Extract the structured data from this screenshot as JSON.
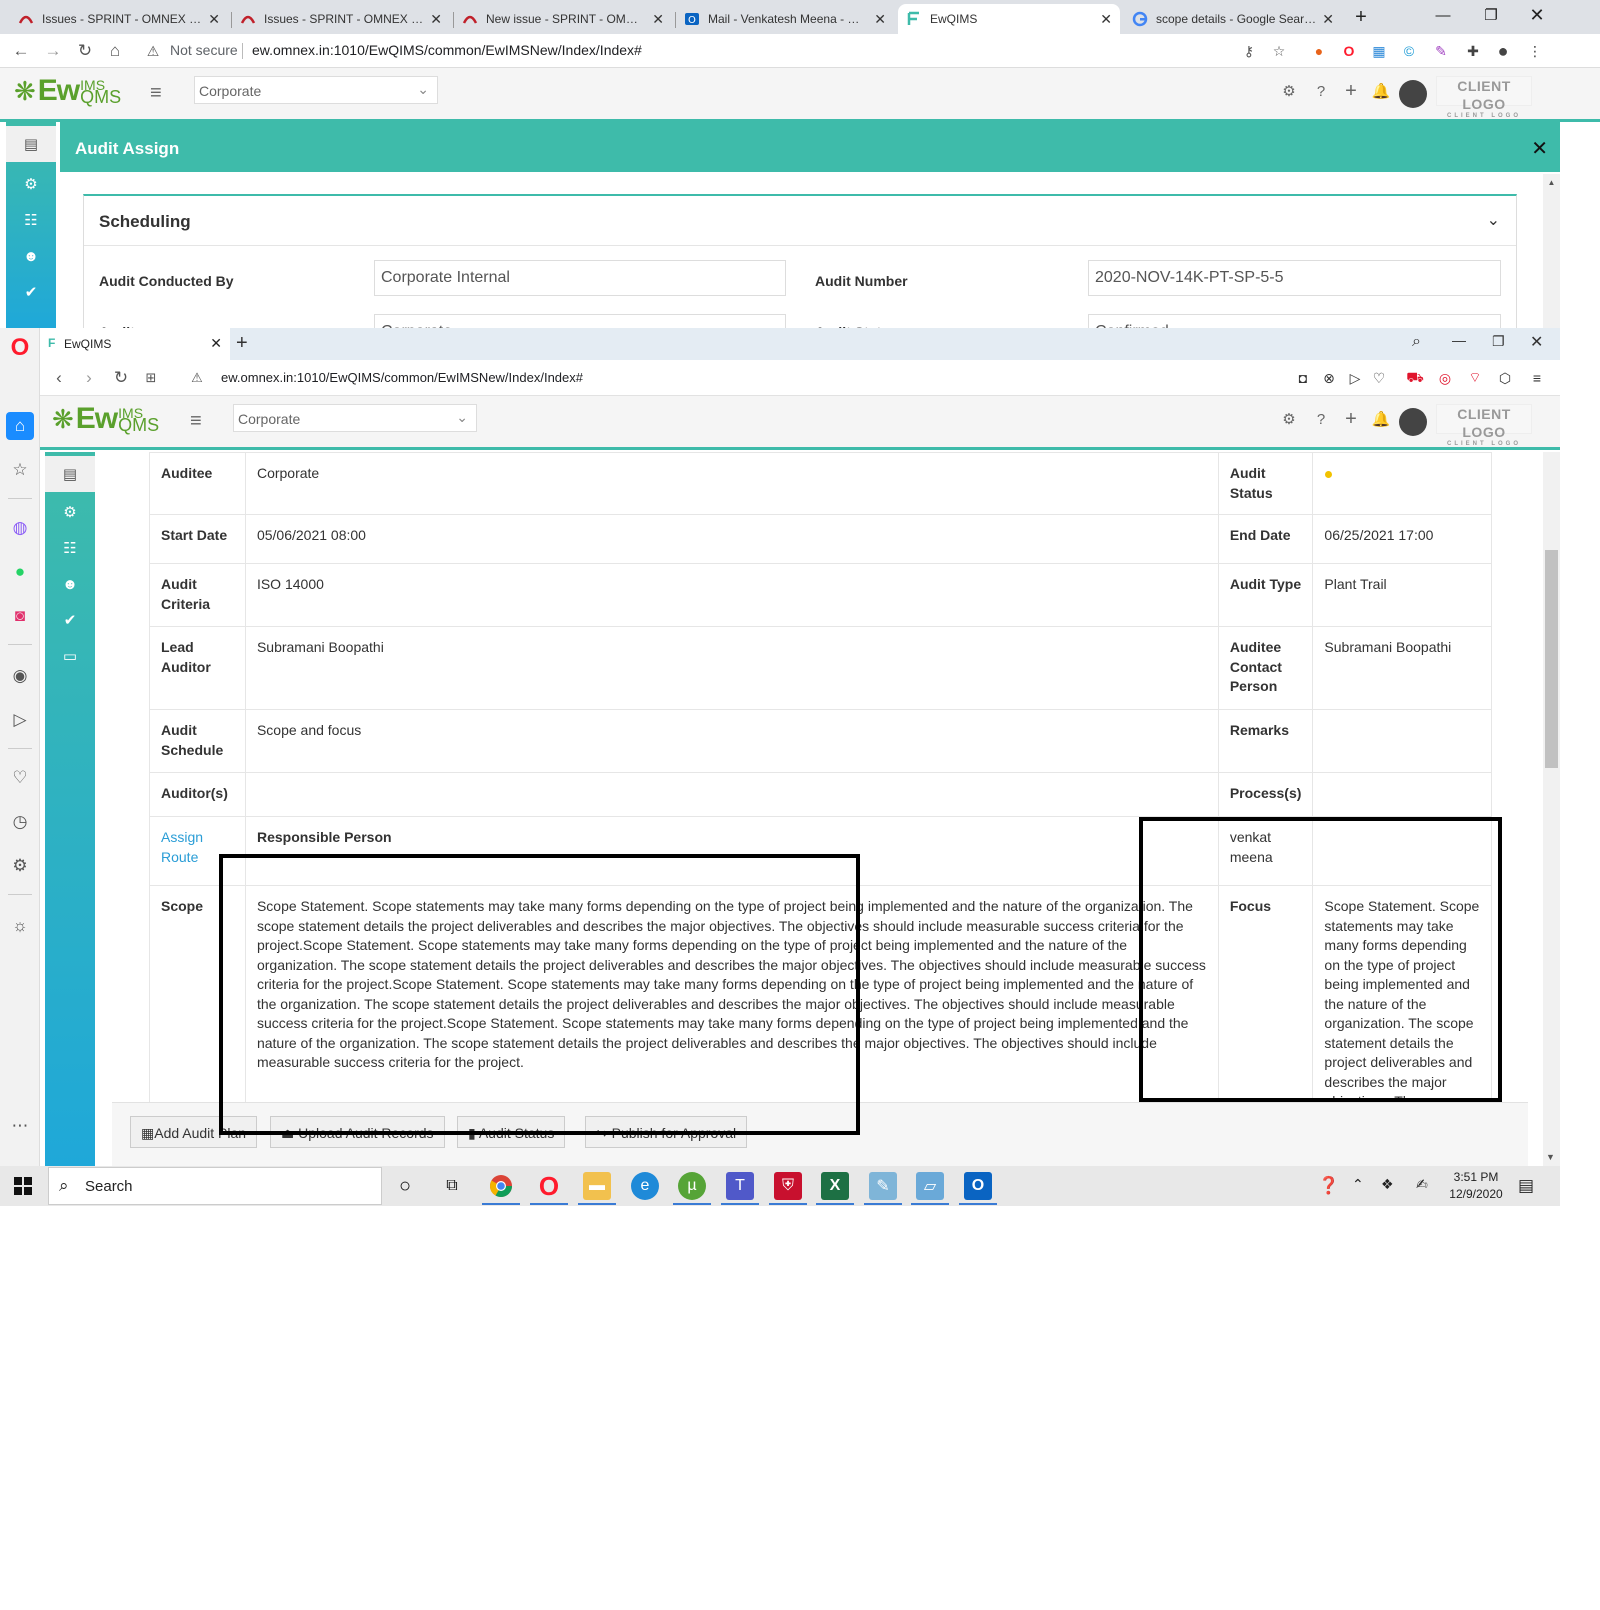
{
  "outer_browser": {
    "tabs": [
      {
        "title": "Issues - SPRINT - OMNEX ISSUE"
      },
      {
        "title": "Issues - SPRINT - OMNEX ISSUE"
      },
      {
        "title": "New issue - SPRINT - OMNEX ISSUE"
      },
      {
        "title": "Mail - Venkatesh Meena - Outlook"
      },
      {
        "title": "EwQIMS"
      },
      {
        "title": "scope details - Google Search"
      }
    ],
    "security_label": "Not secure",
    "url": "ew.omnex.in:1010/EwQIMS/common/EwIMSNew/Index/Index#"
  },
  "app_header": {
    "logo_ew": "Ew",
    "logo_ims": "IMS",
    "logo_qms": "QMS",
    "selector_value": "Corporate",
    "client_logo": "CLIENT LOGO",
    "client_logo_sub": "CLIENT LOGO"
  },
  "audit_assign": {
    "title": "Audit Assign",
    "section_title": "Scheduling",
    "fields": {
      "conducted_by_label": "Audit Conducted By",
      "conducted_by_value": "Corporate Internal",
      "audit_number_label": "Audit Number",
      "audit_number_value": "2020-NOV-14K-PT-SP-5-5",
      "auditee_label": "Auditee",
      "auditee_value": "Corporate",
      "audit_status_label": "Audit Status",
      "audit_status_value": "Confirmed"
    }
  },
  "inner_browser": {
    "tab_title": "EwQIMS",
    "url": "ew.omnex.in:1010/EwQIMS/common/EwIMSNew/Index/Index#"
  },
  "details": {
    "auditee_label": "Auditee",
    "auditee_value": "Corporate",
    "audit_status_label": "Audit Status",
    "start_date_label": "Start Date",
    "start_date_value": "05/06/2021 08:00",
    "end_date_label": "End Date",
    "end_date_value": "06/25/2021 17:00",
    "criteria_label": "Audit Criteria",
    "criteria_value": "ISO 14000",
    "audit_type_label": "Audit Type",
    "audit_type_value": "Plant Trail",
    "lead_auditor_label": "Lead Auditor",
    "lead_auditor_value": "Subramani Boopathi",
    "contact_label": "Auditee Contact Person",
    "contact_value": "Subramani Boopathi",
    "schedule_label": "Audit Schedule",
    "schedule_value": "Scope and focus",
    "remarks_label": "Remarks",
    "auditors_label": "Auditor(s)",
    "processes_label": "Process(s)",
    "assign_route_label": "Assign Route",
    "responsible_label": "Responsible Person",
    "responsible_value": "venkat meena",
    "scope_label": "Scope",
    "scope_value": "Scope Statement. Scope statements may take many forms depending on the type of project being implemented and the nature of the organization. The scope statement details the project deliverables and describes the major objectives. The objectives should include measurable success criteria for the project.Scope Statement. Scope statements may take many forms depending on the type of project being implemented and the nature of the organization. The scope statement details the project deliverables and describes the major objectives. The objectives should include measurable success criteria for the project.Scope Statement. Scope statements may take many forms depending on the type of project being implemented and the nature of the organization. The scope statement details the project deliverables and describes the major objectives. The objectives should include measurable success criteria for the project.Scope Statement. Scope statements may take many forms depending on the type of project being implemented and the nature of the organization. The scope statement details the project deliverables and describes the major objectives. The objectives should include measurable success criteria for the project.",
    "focus_label": "Focus",
    "focus_value": "Scope Statement. Scope statements may take many forms depending on the type of project being implemented and the nature of the organization. The scope statement details the project deliverables and describes the major objectives. The"
  },
  "actions": {
    "add_plan": "Add Audit Plan",
    "upload_records": "Upload Audit Records",
    "audit_status": "Audit Status",
    "publish": "Publish for Approval"
  },
  "taskbar": {
    "search_label": "Search",
    "time": "3:51 PM",
    "date": "12/9/2020"
  },
  "colors": {
    "teal": "#3ebbaa",
    "link_blue": "#2a9dd6",
    "status_yellow": "#f2c200"
  }
}
